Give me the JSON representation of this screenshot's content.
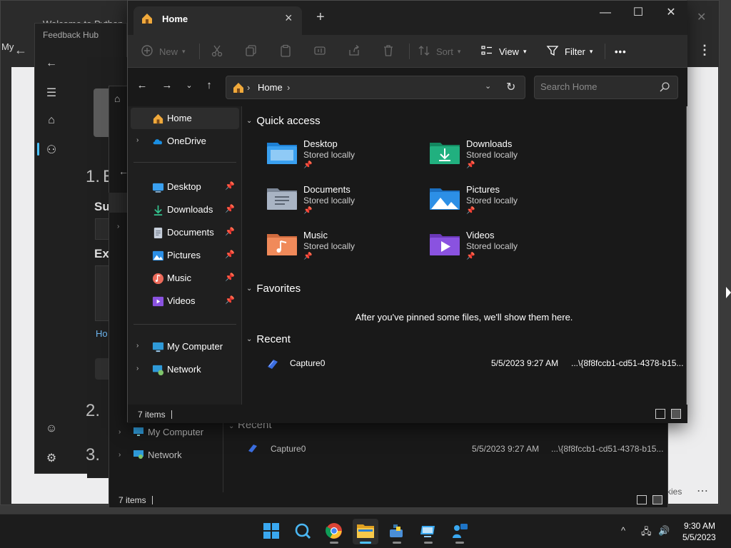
{
  "background": {
    "browser": {
      "title": "Welcome to Python...",
      "side_text": "My",
      "close_glyph": "✕",
      "menu_glyph": "⋮",
      "cookies_text": "kies",
      "dots": "⋯"
    },
    "feedback_hub": {
      "title": "Feedback Hub",
      "steps": [
        "1.",
        "2.",
        "3."
      ],
      "step_1_title_fragment": "E",
      "sub_labels": [
        "Su",
        "Ex"
      ],
      "link_fragment": "Ho"
    },
    "explorer": {
      "nav": [
        "My Computer",
        "Network"
      ],
      "recent_header": "Recent",
      "recent_item": {
        "name": "Capture0",
        "date": "5/5/2023 9:27 AM",
        "location": "...\\{8f8fccb1-cd51-4378-b15..."
      },
      "status": "7 items"
    }
  },
  "window": {
    "tab_label": "Home",
    "new_tab": "+",
    "controls": {
      "minimize": "—",
      "maximize": "☐",
      "close": "✕"
    },
    "toolbar": {
      "new_label": "New",
      "sort_label": "Sort",
      "view_label": "View",
      "filter_label": "Filter",
      "more_label": "•••"
    },
    "address": {
      "path": "Home",
      "sep": "›"
    },
    "search": {
      "placeholder": "Search Home"
    },
    "nav_pane": {
      "items": [
        {
          "label": "Home",
          "icon": "home-icon"
        },
        {
          "label": "OneDrive",
          "icon": "cloud-icon"
        },
        {
          "label": "Desktop",
          "icon": "desktop-icon",
          "pinned": true
        },
        {
          "label": "Downloads",
          "icon": "download-icon",
          "pinned": true
        },
        {
          "label": "Documents",
          "icon": "document-icon",
          "pinned": true
        },
        {
          "label": "Pictures",
          "icon": "pictures-icon",
          "pinned": true
        },
        {
          "label": "Music",
          "icon": "music-icon",
          "pinned": true
        },
        {
          "label": "Videos",
          "icon": "videos-icon",
          "pinned": true
        },
        {
          "label": "My Computer",
          "icon": "computer-icon"
        },
        {
          "label": "Network",
          "icon": "network-icon"
        }
      ]
    },
    "quick_access": {
      "header": "Quick access",
      "items": [
        {
          "name": "Desktop",
          "sub": "Stored locally",
          "color": "#3aa0f0"
        },
        {
          "name": "Downloads",
          "sub": "Stored locally",
          "color": "#21b07f"
        },
        {
          "name": "Documents",
          "sub": "Stored locally",
          "color": "#a9b4c4"
        },
        {
          "name": "Pictures",
          "sub": "Stored locally",
          "color": "#2c8fe6"
        },
        {
          "name": "Music",
          "sub": "Stored locally",
          "color": "#f08a5a"
        },
        {
          "name": "Videos",
          "sub": "Stored locally",
          "color": "#8a52e0"
        }
      ]
    },
    "favorites": {
      "header": "Favorites",
      "empty_message": "After you've pinned some files, we'll show them here."
    },
    "recent": {
      "header": "Recent",
      "items": [
        {
          "name": "Capture0",
          "date": "5/5/2023 9:27 AM",
          "location": "...\\{8f8fccb1-cd51-4378-b15..."
        }
      ]
    },
    "status": {
      "count": "7 items"
    }
  },
  "taskbar": {
    "clock": {
      "time": "9:30 AM",
      "date": "5/5/2023"
    },
    "tray": {
      "chevron": "^",
      "network": "🖧",
      "volume": "🔊"
    }
  }
}
